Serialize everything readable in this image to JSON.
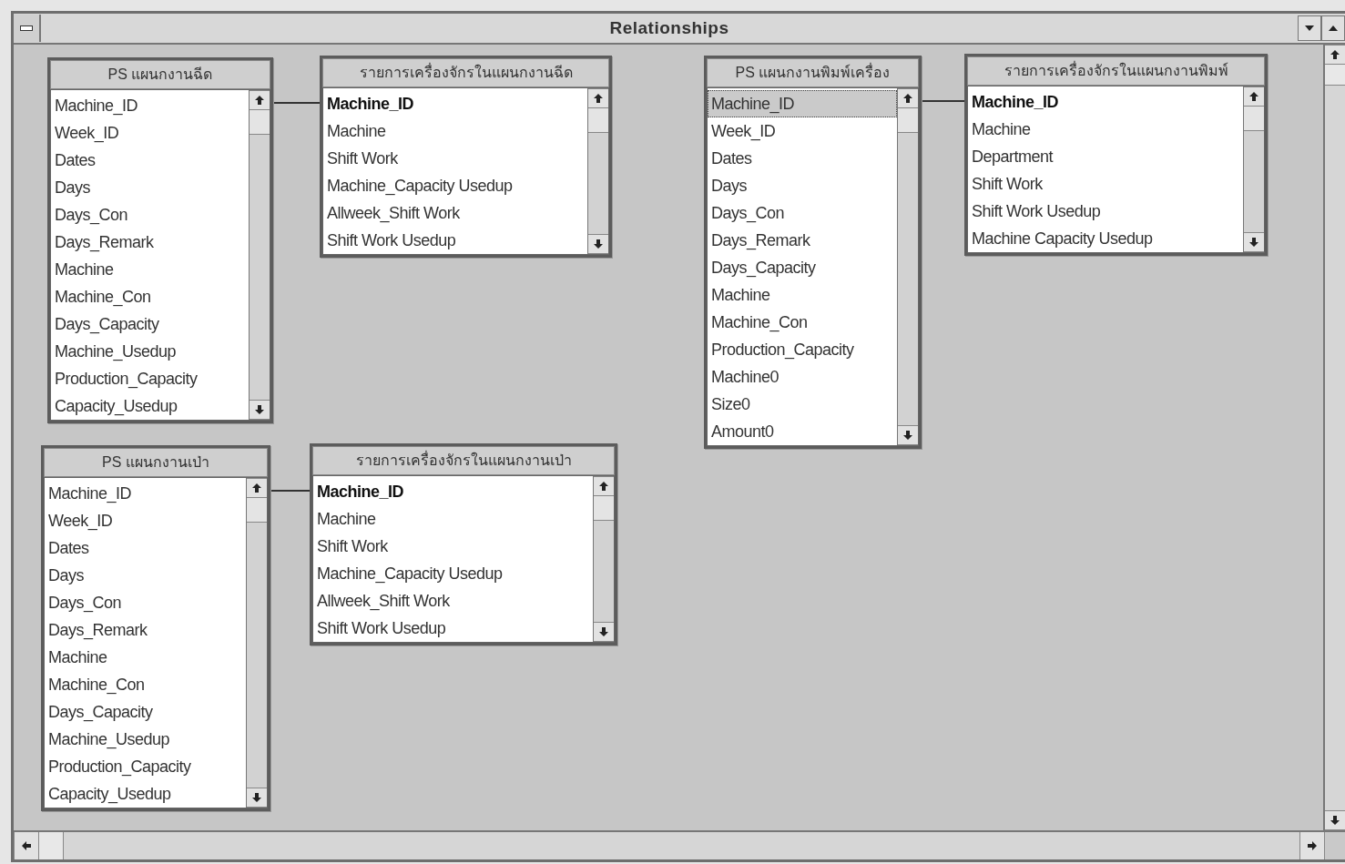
{
  "window": {
    "title": "Relationships"
  },
  "tables": [
    {
      "title": "PS แผนกงานฉีด",
      "linked_right": true,
      "fields": [
        {
          "name": "Machine_ID",
          "key": false,
          "selected": false
        },
        {
          "name": "Week_ID",
          "key": false,
          "selected": false
        },
        {
          "name": "Dates",
          "key": false,
          "selected": false
        },
        {
          "name": "Days",
          "key": false,
          "selected": false
        },
        {
          "name": "Days_Con",
          "key": false,
          "selected": false
        },
        {
          "name": "Days_Remark",
          "key": false,
          "selected": false
        },
        {
          "name": "Machine",
          "key": false,
          "selected": false
        },
        {
          "name": "Machine_Con",
          "key": false,
          "selected": false
        },
        {
          "name": "Days_Capacity",
          "key": false,
          "selected": false
        },
        {
          "name": "Machine_Usedup",
          "key": false,
          "selected": false
        },
        {
          "name": "Production_Capacity",
          "key": false,
          "selected": false
        },
        {
          "name": "Capacity_Usedup",
          "key": false,
          "selected": false
        }
      ]
    },
    {
      "title": "รายการเครื่องจักรในแผนกงานฉีด",
      "linked_right": false,
      "fields": [
        {
          "name": "Machine_ID",
          "key": true,
          "selected": false
        },
        {
          "name": "Machine",
          "key": false,
          "selected": false
        },
        {
          "name": "Shift Work",
          "key": false,
          "selected": false
        },
        {
          "name": "Machine_Capacity Usedup",
          "key": false,
          "selected": false
        },
        {
          "name": "Allweek_Shift Work",
          "key": false,
          "selected": false
        },
        {
          "name": "Shift Work Usedup",
          "key": false,
          "selected": false
        }
      ]
    },
    {
      "title": "PS แผนกงานพิมพ์เครื่อง",
      "linked_right": true,
      "fields": [
        {
          "name": "Machine_ID",
          "key": false,
          "selected": true
        },
        {
          "name": "Week_ID",
          "key": false,
          "selected": false
        },
        {
          "name": "Dates",
          "key": false,
          "selected": false
        },
        {
          "name": "Days",
          "key": false,
          "selected": false
        },
        {
          "name": "Days_Con",
          "key": false,
          "selected": false
        },
        {
          "name": "Days_Remark",
          "key": false,
          "selected": false
        },
        {
          "name": "Days_Capacity",
          "key": false,
          "selected": false
        },
        {
          "name": "Machine",
          "key": false,
          "selected": false
        },
        {
          "name": "Machine_Con",
          "key": false,
          "selected": false
        },
        {
          "name": "Production_Capacity",
          "key": false,
          "selected": false
        },
        {
          "name": "Machine0",
          "key": false,
          "selected": false
        },
        {
          "name": "Size0",
          "key": false,
          "selected": false
        },
        {
          "name": "Amount0",
          "key": false,
          "selected": false
        }
      ]
    },
    {
      "title": "รายการเครื่องจักรในแผนกงานพิมพ์",
      "linked_right": false,
      "fields": [
        {
          "name": "Machine_ID",
          "key": true,
          "selected": false
        },
        {
          "name": "Machine",
          "key": false,
          "selected": false
        },
        {
          "name": "Department",
          "key": false,
          "selected": false
        },
        {
          "name": "Shift Work",
          "key": false,
          "selected": false
        },
        {
          "name": "Shift Work Usedup",
          "key": false,
          "selected": false
        },
        {
          "name": "Machine Capacity Usedup",
          "key": false,
          "selected": false
        }
      ]
    },
    {
      "title": "PS แผนกงานเป่า",
      "linked_right": true,
      "fields": [
        {
          "name": "Machine_ID",
          "key": false,
          "selected": false
        },
        {
          "name": "Week_ID",
          "key": false,
          "selected": false
        },
        {
          "name": "Dates",
          "key": false,
          "selected": false
        },
        {
          "name": "Days",
          "key": false,
          "selected": false
        },
        {
          "name": "Days_Con",
          "key": false,
          "selected": false
        },
        {
          "name": "Days_Remark",
          "key": false,
          "selected": false
        },
        {
          "name": "Machine",
          "key": false,
          "selected": false
        },
        {
          "name": "Machine_Con",
          "key": false,
          "selected": false
        },
        {
          "name": "Days_Capacity",
          "key": false,
          "selected": false
        },
        {
          "name": "Machine_Usedup",
          "key": false,
          "selected": false
        },
        {
          "name": "Production_Capacity",
          "key": false,
          "selected": false
        },
        {
          "name": "Capacity_Usedup",
          "key": false,
          "selected": false
        }
      ]
    },
    {
      "title": "รายการเครื่องจักรในแผนกงานเป่า",
      "linked_right": false,
      "fields": [
        {
          "name": "Machine_ID",
          "key": true,
          "selected": false
        },
        {
          "name": "Machine",
          "key": false,
          "selected": false
        },
        {
          "name": "Shift Work",
          "key": false,
          "selected": false
        },
        {
          "name": "Machine_Capacity Usedup",
          "key": false,
          "selected": false
        },
        {
          "name": "Allweek_Shift Work",
          "key": false,
          "selected": false
        },
        {
          "name": "Shift Work Usedup",
          "key": false,
          "selected": false
        }
      ]
    }
  ]
}
